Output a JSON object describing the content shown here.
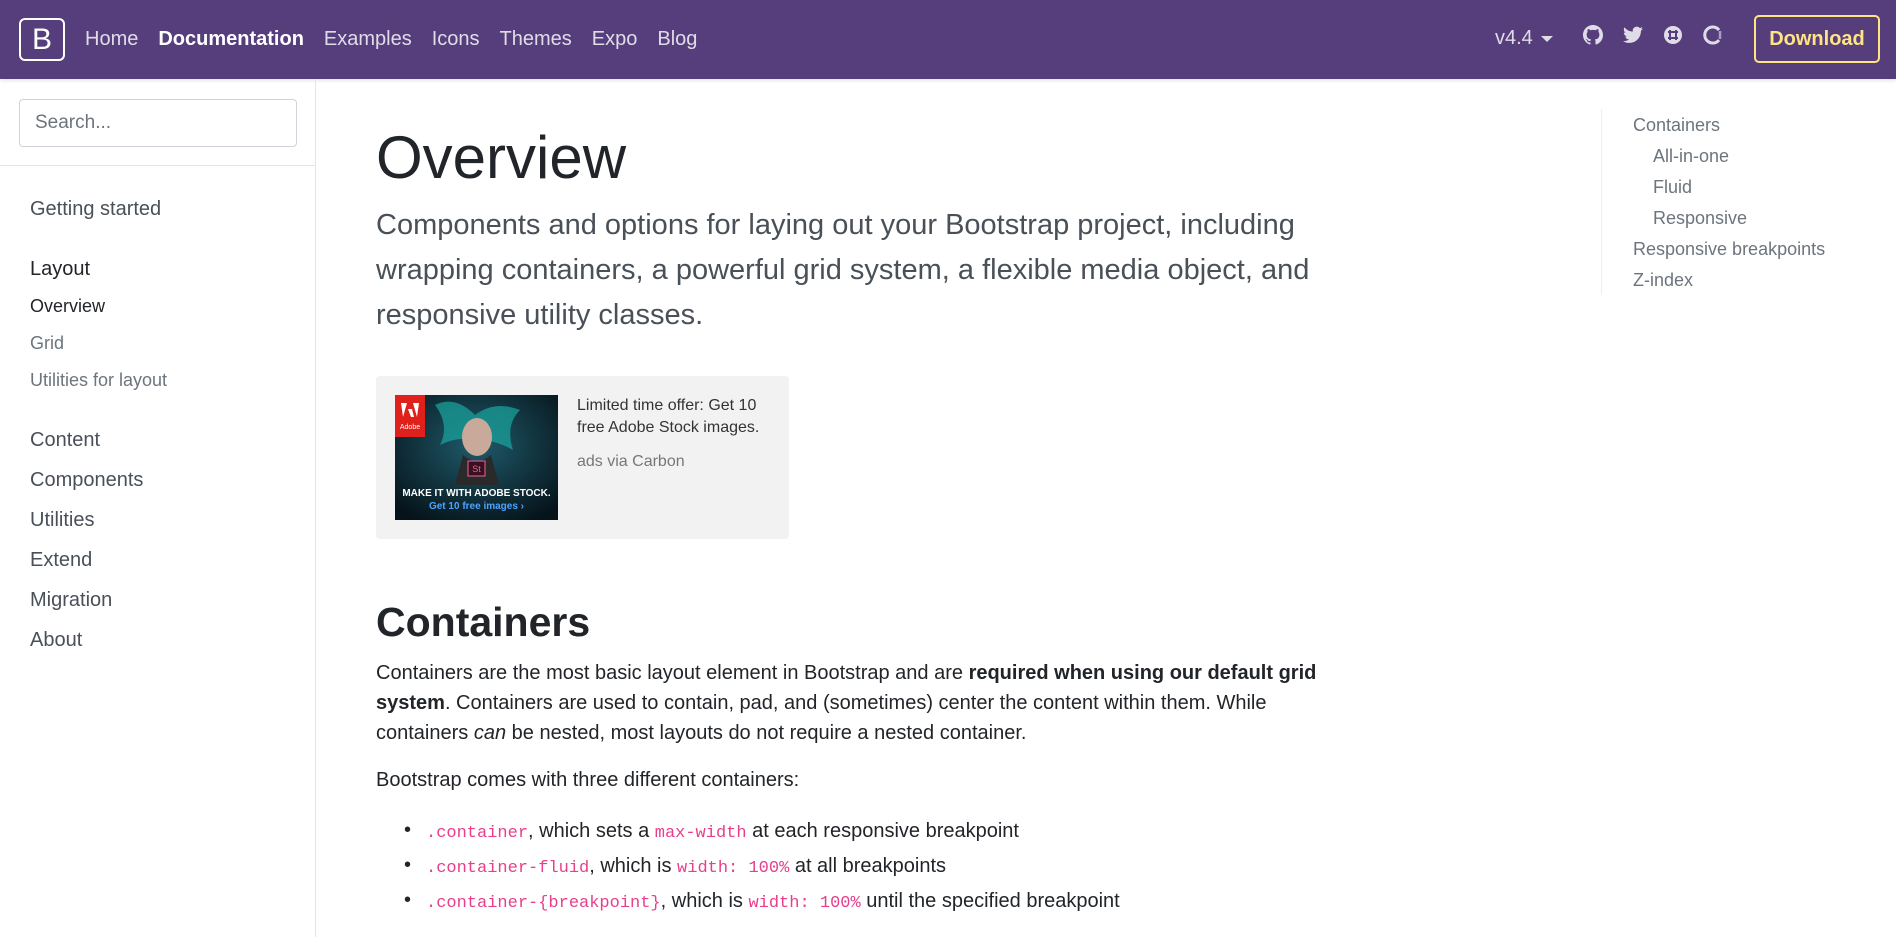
{
  "navbar": {
    "brand": "B",
    "links": [
      "Home",
      "Documentation",
      "Examples",
      "Icons",
      "Themes",
      "Expo",
      "Blog"
    ],
    "active": "Documentation",
    "version": "v4.4",
    "icons": [
      "github-icon",
      "twitter-icon",
      "slack-icon",
      "opencollective-icon"
    ],
    "download_label": "Download",
    "bg_color": "#563d7c",
    "download_color": "#ffe484"
  },
  "sidebar": {
    "search_placeholder": "Search...",
    "groups": [
      {
        "label": "Getting started"
      },
      {
        "label": "Layout",
        "items": [
          "Overview",
          "Grid",
          "Utilities for layout"
        ],
        "active_item": "Overview"
      },
      {
        "label": "Content"
      },
      {
        "label": "Components"
      },
      {
        "label": "Utilities"
      },
      {
        "label": "Extend"
      },
      {
        "label": "Migration"
      },
      {
        "label": "About"
      }
    ]
  },
  "main": {
    "title": "Overview",
    "lead": "Components and options for laying out your Bootstrap project, including wrapping containers, a powerful grid system, a flexible media object, and responsive utility classes.",
    "ad": {
      "text": "Limited time offer: Get 10 free Adobe Stock images.",
      "via": "ads via Carbon",
      "image_logo": "Adobe",
      "image_badge": "St",
      "image_headline": "MAKE IT WITH ADOBE STOCK.",
      "image_cta": "Get 10 free images ›"
    },
    "section_title": "Containers",
    "p1": {
      "start": "Containers are the most basic layout element in Bootstrap and are ",
      "bold": "required when using our default grid system",
      "mid": ". Containers are used to contain, pad, and (sometimes) center the content within them. While containers ",
      "italic": "can",
      "end": " be nested, most layouts do not require a nested container."
    },
    "p2": "Bootstrap comes with three different containers:",
    "list": [
      {
        "code1": ".container",
        "text1": ", which sets a ",
        "code2": "max-width",
        "text2": " at each responsive breakpoint"
      },
      {
        "code1": ".container-fluid",
        "text1": ", which is ",
        "code2": "width: 100%",
        "text2": " at all breakpoints"
      },
      {
        "code1": ".container-{breakpoint}",
        "text1": ", which is ",
        "code2": "width: 100%",
        "text2": " until the specified breakpoint"
      }
    ]
  },
  "toc": {
    "items": [
      {
        "label": "Containers",
        "level": 1
      },
      {
        "label": "All-in-one",
        "level": 2
      },
      {
        "label": "Fluid",
        "level": 2
      },
      {
        "label": "Responsive",
        "level": 2
      },
      {
        "label": "Responsive breakpoints",
        "level": 1
      },
      {
        "label": "Z-index",
        "level": 1
      }
    ]
  }
}
